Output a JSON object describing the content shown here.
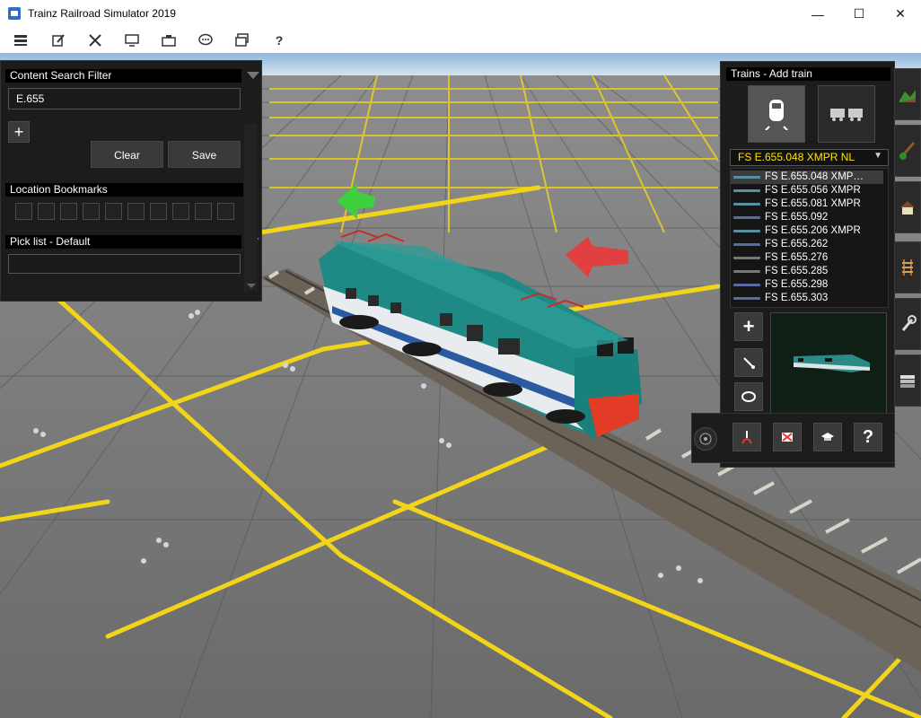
{
  "window": {
    "title": "Trainz Railroad Simulator 2019",
    "minimize": "—",
    "maximize": "☐",
    "close": "✕"
  },
  "toolbar": {
    "icons": [
      "menu-icon",
      "edit-icon",
      "tools-icon",
      "display-icon",
      "camera-icon",
      "chat-icon",
      "layers-icon",
      "help-icon"
    ],
    "help_glyph": "?"
  },
  "content_search": {
    "header": "Content Search Filter",
    "query": "E.655",
    "add_glyph": "+",
    "clear_label": "Clear",
    "save_label": "Save"
  },
  "bookmarks": {
    "header": "Location Bookmarks",
    "slots": 10
  },
  "picklist": {
    "header": "Pick list - Default",
    "value": ""
  },
  "trains": {
    "header": "Trains - Add train",
    "selected": "FS E.655.048 XMPR NL",
    "items": [
      "FS E.655.048 XMP…",
      "FS E.655.056 XMPR",
      "FS E.655.081 XMPR",
      "FS E.655.092",
      "FS E.655.206 XMPR",
      "FS E.655.262",
      "FS E.655.276",
      "FS E.655.285",
      "FS E.655.298",
      "FS E.655.303"
    ],
    "add_glyph": "+",
    "help_glyph": "?"
  },
  "colors": {
    "panel_bg": "#1c1c1c",
    "selected_text": "#ffe700",
    "grid_yellow": "#f2d51a",
    "locomotive_teal": "#1f8a85",
    "arrow_green": "#3ecf3e",
    "arrow_red": "#e04040"
  }
}
